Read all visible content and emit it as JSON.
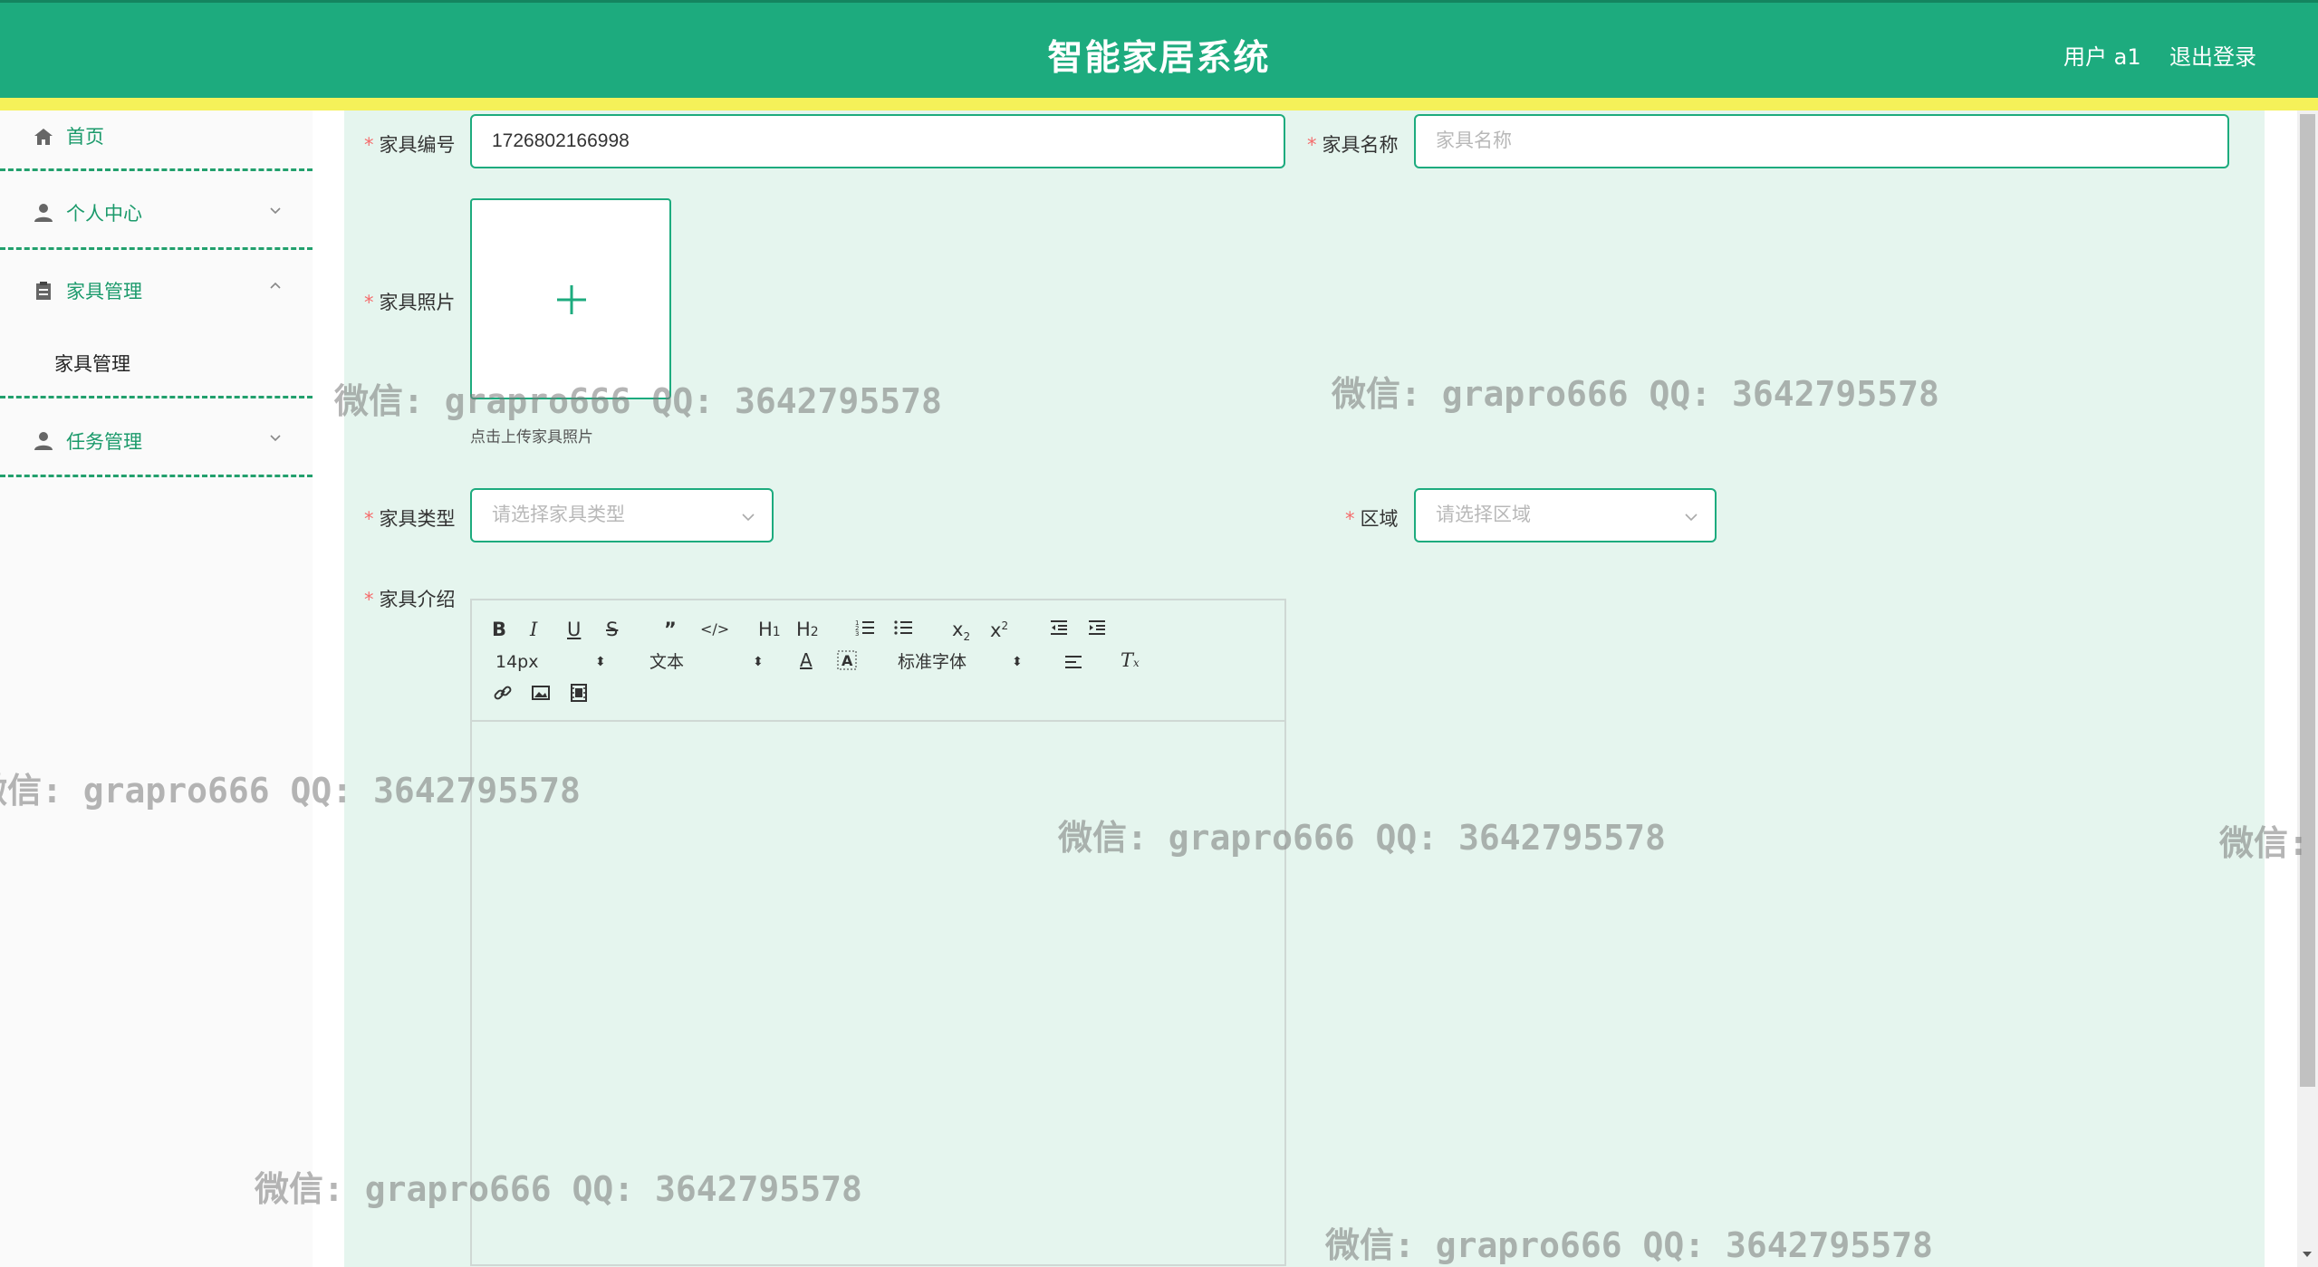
{
  "header": {
    "title": "智能家居系统",
    "user": "用户 a1",
    "logout": "退出登录"
  },
  "sidebar": {
    "items": [
      {
        "label": "首页",
        "icon": "home-icon"
      },
      {
        "label": "个人中心",
        "icon": "user-icon",
        "expanded": false
      },
      {
        "label": "家具管理",
        "icon": "clipboard-icon",
        "expanded": true
      },
      {
        "label": "任务管理",
        "icon": "user-icon",
        "expanded": false
      }
    ],
    "subitem": "家具管理"
  },
  "form": {
    "code_label": "家具编号",
    "code_value": "1726802166998",
    "name_label": "家具名称",
    "name_placeholder": "家具名称",
    "photo_label": "家具照片",
    "photo_tip": "点击上传家具照片",
    "type_label": "家具类型",
    "type_placeholder": "请选择家具类型",
    "area_label": "区域",
    "area_placeholder": "请选择区域",
    "intro_label": "家具介绍",
    "required_mark": "*"
  },
  "editor": {
    "size": "14px",
    "header": "文本",
    "font": "标准字体"
  },
  "watermark": "微信: grapro666 QQ: 3642795578",
  "colors": {
    "header": "#1dab7e",
    "stripe": "#f5f159",
    "panel": "#e5f5ee",
    "accent": "#1dab7e"
  }
}
